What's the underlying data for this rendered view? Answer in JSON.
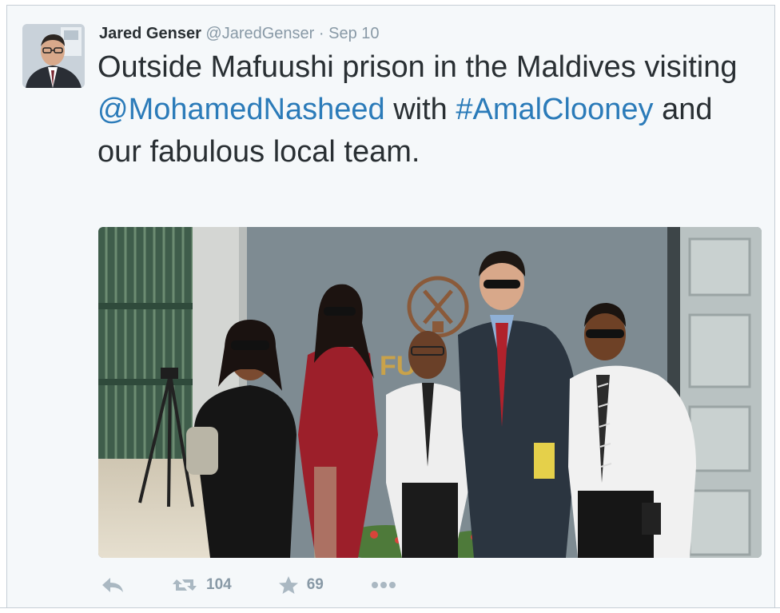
{
  "tweet": {
    "author_name": "Jared Genser",
    "author_handle": "@JaredGenser",
    "separator": "·",
    "date": "Sep 10",
    "text_parts": {
      "part1": "Outside Mafuushi prison in the Maldives visiting ",
      "mention": "@MohamedNasheed",
      "part2": " with ",
      "hashtag": "#AmalClooney",
      "part3": " and our fabulous local team."
    },
    "photo_sign_text": "FU"
  },
  "actions": {
    "reply": {
      "icon": "reply-icon"
    },
    "retweet": {
      "icon": "retweet-icon",
      "count": "104"
    },
    "favorite": {
      "icon": "star-icon",
      "count": "69"
    },
    "more": {
      "icon": "more-dots-icon"
    }
  },
  "colors": {
    "link": "#2b7bb9",
    "text": "#292f33",
    "muted": "#8899a6",
    "action_icon": "#aab8c2",
    "background": "#f5f8fa"
  }
}
